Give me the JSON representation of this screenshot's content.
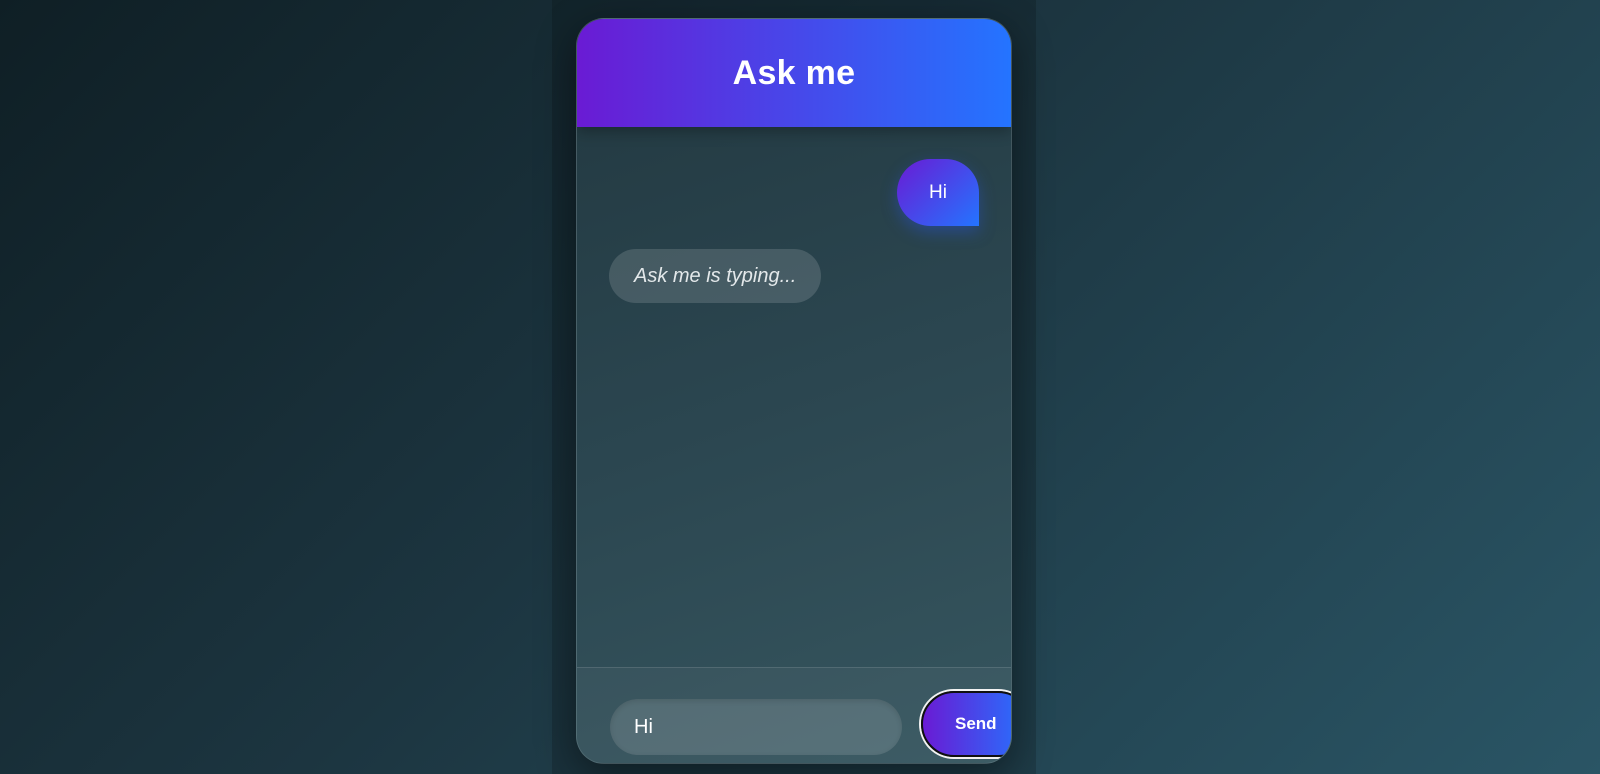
{
  "app": {
    "title": "Ask me"
  },
  "messages": [
    {
      "sender": "user",
      "text": "Hi"
    },
    {
      "sender": "assistant",
      "text": "Ask me is typing..."
    }
  ],
  "composer": {
    "input_value": "Hi",
    "send_label": "Send"
  },
  "colors": {
    "accent_start": "#6a1bd4",
    "accent_end": "#2474ff",
    "background_dark": "#0f1f25",
    "background_light": "#2a5565",
    "typing_bubble": "rgba(255,255,255,0.14)"
  }
}
